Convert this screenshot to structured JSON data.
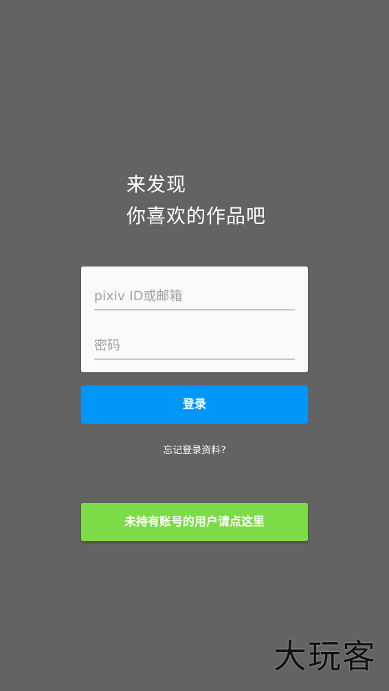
{
  "headline": {
    "line1": "来发现",
    "line2": "你喜欢的作品吧"
  },
  "login_form": {
    "username_placeholder": "pixiv ID或邮箱",
    "username_value": "",
    "password_placeholder": "密码",
    "password_value": ""
  },
  "buttons": {
    "login_label": "登录",
    "forgot_label": "忘记登录资料?",
    "signup_label": "未持有账号的用户请点这里"
  },
  "watermark": {
    "text": "大玩客"
  },
  "colors": {
    "background": "#636363",
    "primary_button": "#0096fa",
    "signup_button": "#7cdc46",
    "card": "#fafafa"
  }
}
